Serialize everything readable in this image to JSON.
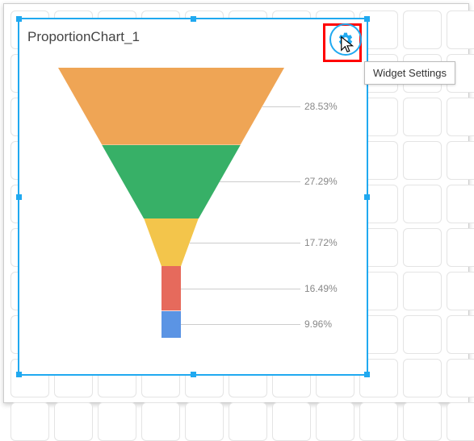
{
  "widget": {
    "title": "ProportionChart_1",
    "tooltip": "Widget Settings"
  },
  "chart_data": {
    "type": "funnel",
    "title": "",
    "series": [
      {
        "value": 28.53,
        "label": "28.53%",
        "color": "#efa555"
      },
      {
        "value": 27.29,
        "label": "27.29%",
        "color": "#37b067"
      },
      {
        "value": 17.72,
        "label": "17.72%",
        "color": "#f3c54b"
      },
      {
        "value": 16.49,
        "label": "16.49%",
        "color": "#e66a5c"
      },
      {
        "value": 9.96,
        "label": "9.96%",
        "color": "#5b94e4"
      }
    ],
    "label_format": "percent",
    "ylim": [
      0,
      100
    ]
  }
}
